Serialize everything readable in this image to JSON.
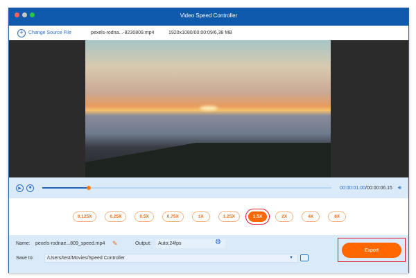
{
  "window": {
    "title": "Video Speed Controller"
  },
  "toolbar": {
    "change_source": "Change Source File",
    "file_name": "pexels-rodna...-8230809.mp4",
    "file_info": "1920x1080/00:00:09/6,38 MB"
  },
  "player": {
    "current_time": "00:00:01.00",
    "total_time": "/00:00:06.15",
    "progress": 0.16
  },
  "speeds": [
    "0.125X",
    "0.25X",
    "0.5X",
    "0.75X",
    "1X",
    "1.25X",
    "1.5X",
    "2X",
    "4X",
    "8X"
  ],
  "selected_speed": "1.5X",
  "bottom": {
    "name_label": "Name:",
    "name_value": "pexels-rodnae...809_speed.mp4",
    "output_label": "Output:",
    "output_value": "Auto;24fps",
    "save_label": "Save to:",
    "save_path": "/Users/test/Movies/Speed Controller",
    "export": "Export"
  },
  "colors": {
    "accent": "#ff6700",
    "title_bar": "#0f5aad"
  }
}
